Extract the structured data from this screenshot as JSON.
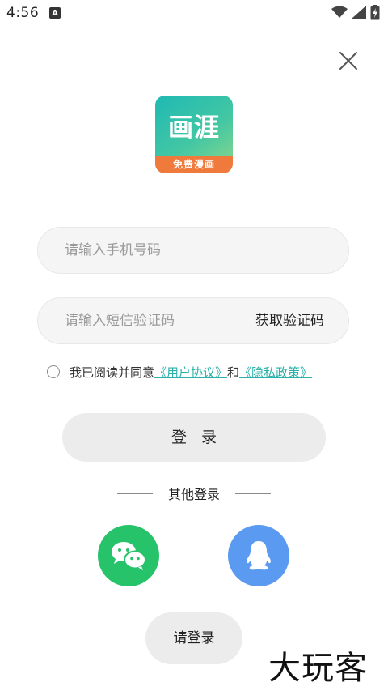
{
  "status_bar": {
    "time": "4:56",
    "notification_badge": "A"
  },
  "logo": {
    "main_text": "画涯",
    "sub_text": "免费漫画",
    "gradient_start": "#1fb9b4",
    "gradient_end": "#8fd88a",
    "bar_color": "#f07a3c"
  },
  "form": {
    "phone_placeholder": "请输入手机号码",
    "code_placeholder": "请输入短信验证码",
    "get_code_label": "获取验证码"
  },
  "agreement": {
    "prefix": "我已阅读并同意",
    "user_agreement": "《用户协议》",
    "and": "和",
    "privacy_policy": "《隐私政策》",
    "checked": false,
    "link_color": "#2ab0a8"
  },
  "login_button": {
    "label": "登录"
  },
  "other_login": {
    "title": "其他登录",
    "wechat_color": "#27c36a",
    "qq_color": "#5a9af0"
  },
  "please_login": {
    "label": "请登录"
  },
  "watermark": {
    "text": "大玩客"
  },
  "icons": {
    "close": "close-icon",
    "wechat": "wechat-icon",
    "qq": "qq-icon",
    "wifi": "wifi-icon",
    "signal": "signal-icon",
    "battery": "battery-charging-icon"
  }
}
